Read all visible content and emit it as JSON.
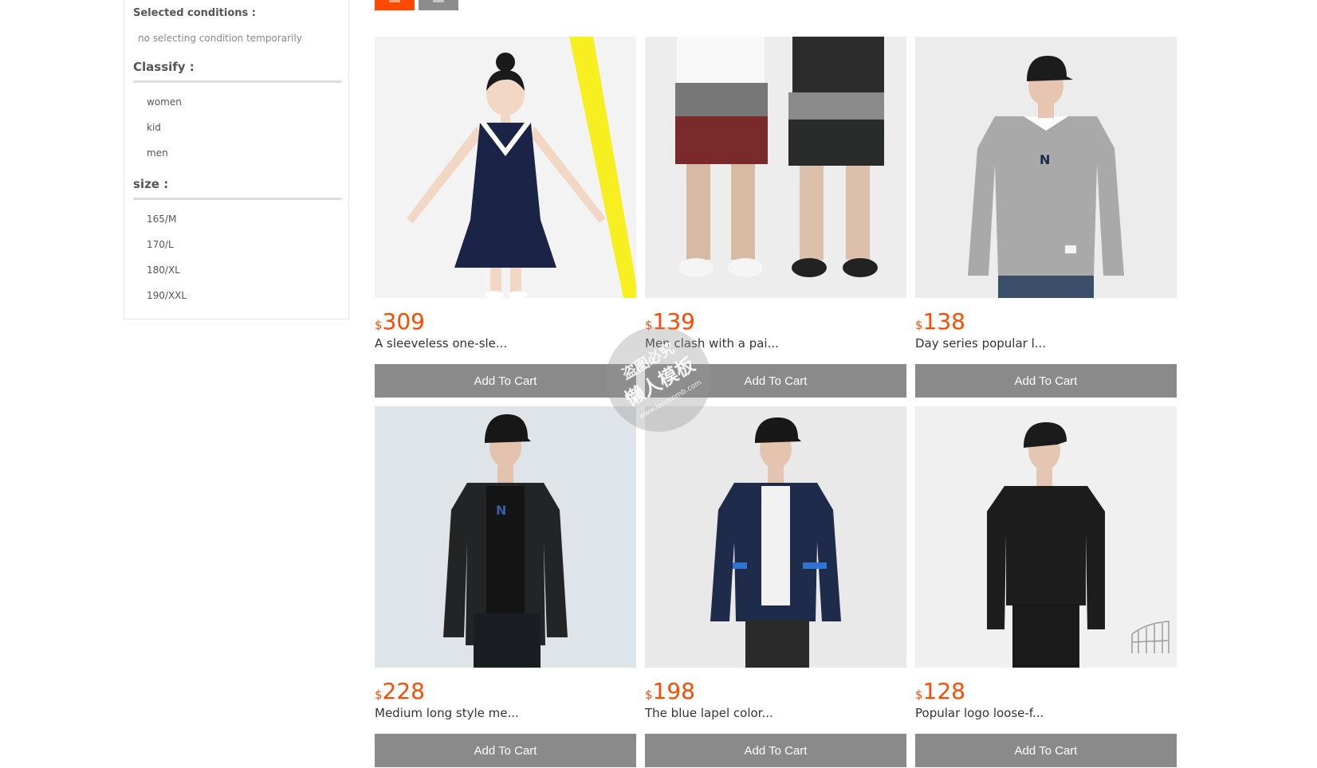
{
  "filters": {
    "selected_title": "Selected conditions :",
    "selected_empty": "no selecting condition temporarily",
    "classify": {
      "title": "Classify :",
      "options": [
        "women",
        "kid",
        "men"
      ]
    },
    "size": {
      "title": "size :",
      "options": [
        "165/M",
        "170/L",
        "180/XL",
        "190/XXL"
      ]
    }
  },
  "sort_buttons": [
    {
      "icon": "sort-icon",
      "color": "#ff4a00"
    },
    {
      "icon": "sort-icon",
      "color": "#8c8c8c"
    }
  ],
  "products": [
    {
      "currency": "$",
      "price": "309",
      "name": "A sleeveless one-sle...",
      "button": "Add To Cart",
      "image": "girl-navy-dress"
    },
    {
      "currency": "$",
      "price": "139",
      "name": "Men clash with a pai...",
      "button": "Add To Cart",
      "image": "couple-shorts"
    },
    {
      "currency": "$",
      "price": "138",
      "name": "Day series popular l...",
      "button": "Add To Cart",
      "image": "grey-sweatshirt"
    },
    {
      "currency": "$",
      "price": "228",
      "name": "Medium long style me...",
      "button": "Add To Cart",
      "image": "black-long-jacket"
    },
    {
      "currency": "$",
      "price": "198",
      "name": "The blue lapel color...",
      "button": "Add To Cart",
      "image": "navy-lapel-jacket"
    },
    {
      "currency": "$",
      "price": "128",
      "name": "Popular logo loose-f...",
      "button": "Add To Cart",
      "image": "black-tee"
    }
  ],
  "watermark": {
    "line1": "盗图必究",
    "line2": "懒人模板",
    "line3": "www.lanrenmb.com"
  },
  "colors": {
    "accent": "#ff4a00",
    "button": "#8a8a8a"
  }
}
